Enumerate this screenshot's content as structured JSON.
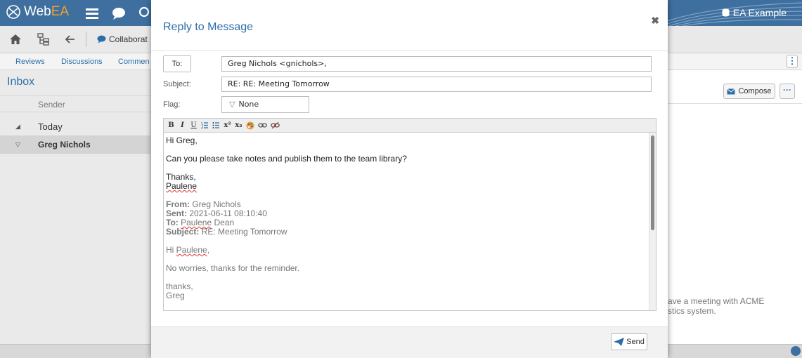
{
  "app": {
    "brand_web": "Web",
    "brand_ea": "EA",
    "model_name": "EA Example",
    "collaborate_label": "Collaborat"
  },
  "tabs": {
    "reviews": "Reviews",
    "discussions": "Discussions",
    "comments": "Commen"
  },
  "inbox": {
    "title": "Inbox",
    "sender_header": "Sender",
    "group_label": "Today",
    "selected_sender": "Greg Nichols"
  },
  "right_panel": {
    "compose_label": "Compose",
    "preview_line1": "ave a meeting with ACME",
    "preview_line2": "stics system."
  },
  "dialog": {
    "title": "Reply to Message",
    "to_button": "To:",
    "to_value": "Greg Nichols <gnichols>,",
    "subject_label": "Subject:",
    "subject_value": "RE: RE: Meeting Tomorrow",
    "flag_label": "Flag:",
    "flag_value": "None",
    "send_label": "Send"
  },
  "editor_toolbar": {
    "bold": "B",
    "italic": "I",
    "underline": "U",
    "superscript": "x²",
    "subscript": "x₂"
  },
  "message": {
    "greeting": "Hi Greg,",
    "line1": "Can you please take notes and publish them to the team library?",
    "thanks": "Thanks,",
    "signature": "Paulene",
    "from_label": "From:",
    "from_value": " Greg Nichols",
    "sent_label": "Sent:",
    "sent_value": " 2021-06-11 08:10:40",
    "to_label": "To:",
    "to_name_first": "Paulene",
    "to_name_last": " Dean",
    "subject_label": "Subject:",
    "subject_value": " RE: Meeting Tomorrow",
    "quoted_greeting_prefix": "Hi ",
    "quoted_greeting_name": "Paulene",
    "quoted_greeting_suffix": ",",
    "quoted_line1": "No worries, thanks for the reminder.",
    "quoted_thanks": "thanks,",
    "quoted_signature": "Greg"
  },
  "colors": {
    "topbar": "#3e6f9e",
    "accent_blue": "#2c6fa8",
    "brand_orange": "#f0a030"
  }
}
